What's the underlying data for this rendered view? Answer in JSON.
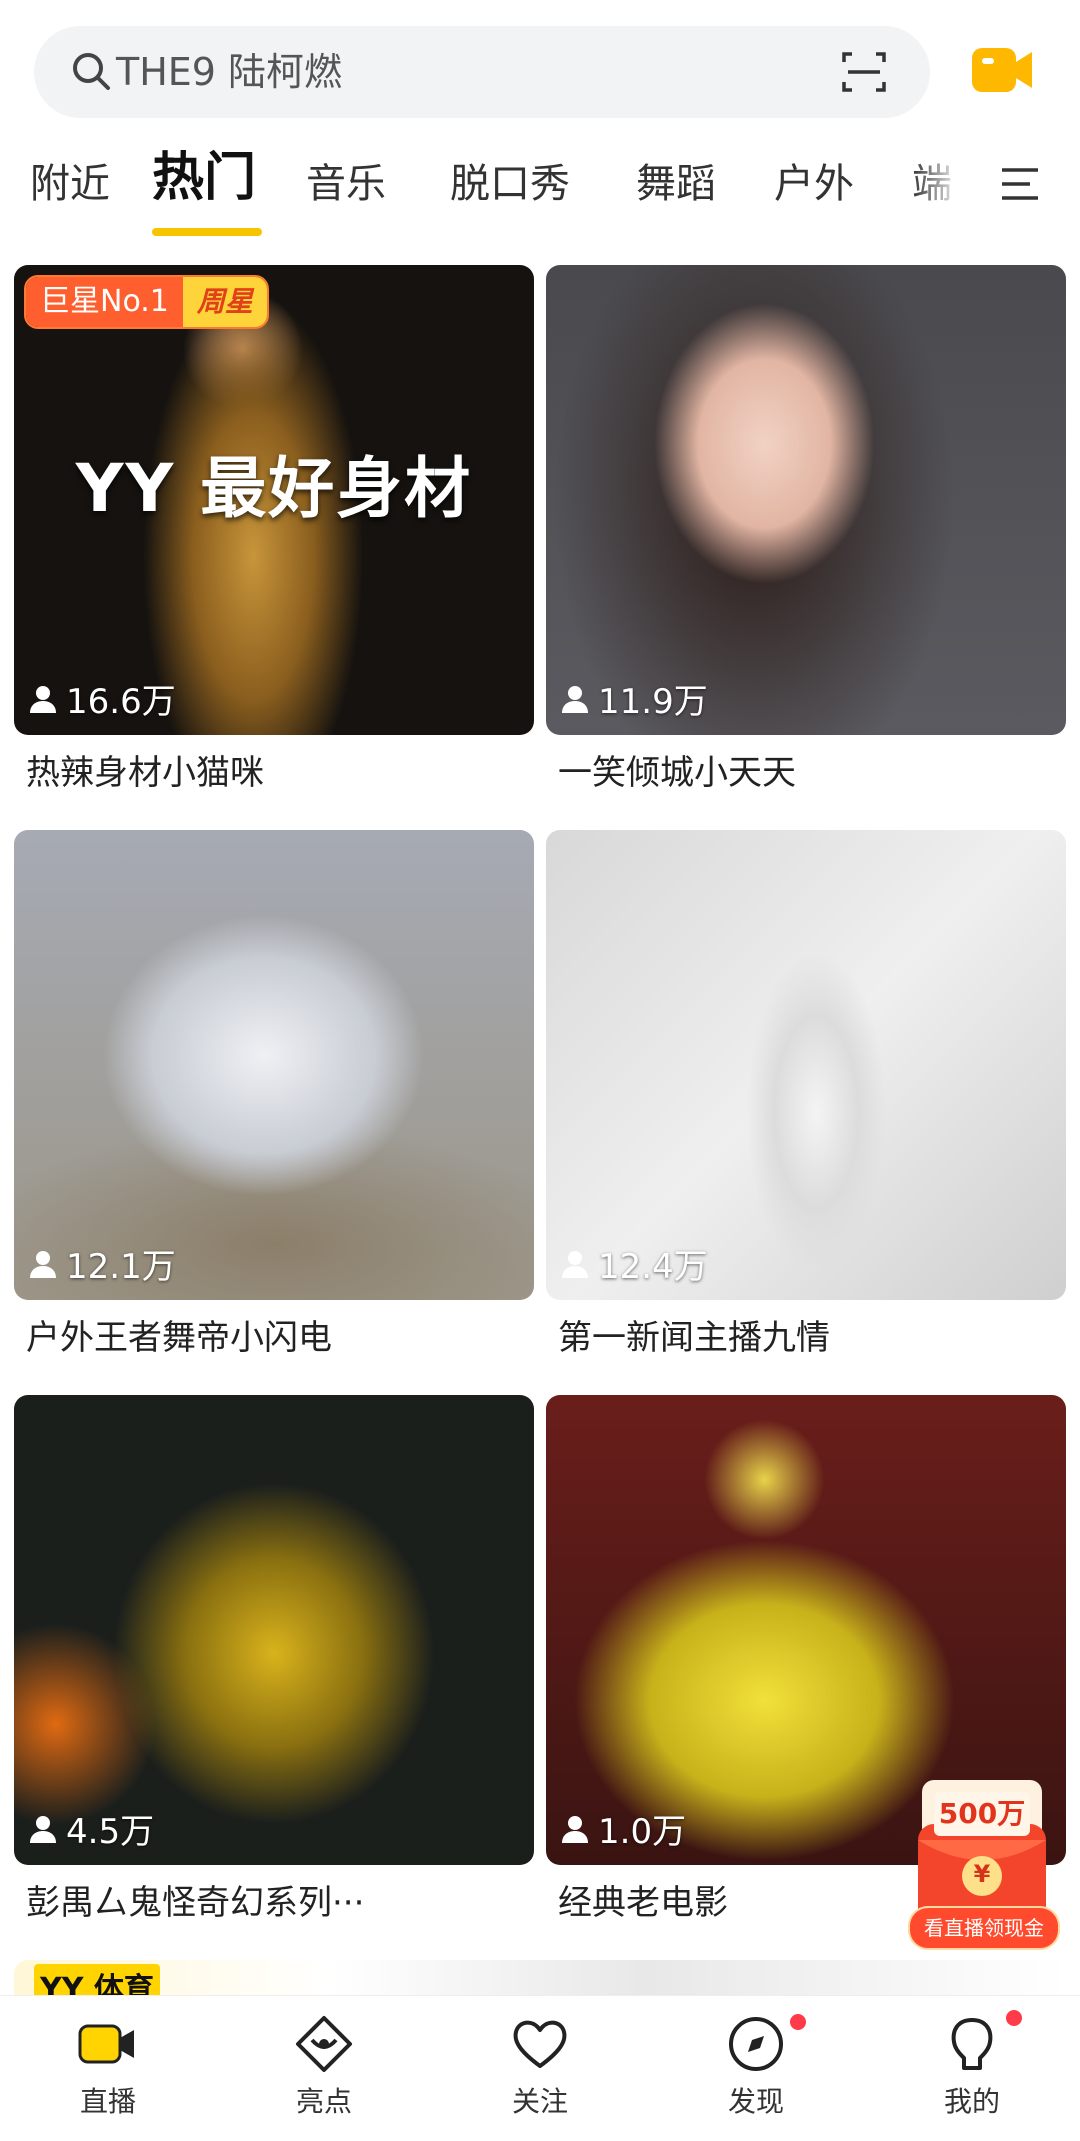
{
  "search": {
    "placeholder_text": "THE9 陆柯燃"
  },
  "tabs": [
    {
      "label": "附近"
    },
    {
      "label": "热门",
      "active": true
    },
    {
      "label": "音乐"
    },
    {
      "label": "脱口秀"
    },
    {
      "label": "舞蹈"
    },
    {
      "label": "户外"
    },
    {
      "label": "端"
    }
  ],
  "cards": [
    {
      "title": "热辣身材小猫咪",
      "viewers": "16.6万",
      "badge_left": "巨星No.1",
      "badge_right": "周星",
      "overlay": "YY 最好身材"
    },
    {
      "title": "一笑倾城小天天",
      "viewers": "11.9万"
    },
    {
      "title": "户外王者舞帝小闪电",
      "viewers": "12.1万"
    },
    {
      "title": "第一新闻主播九情",
      "viewers": "12.4万"
    },
    {
      "title": "彭禺厶鬼怪奇幻系列···",
      "viewers": "4.5万"
    },
    {
      "title": "经典老电影",
      "viewers": "1.0万"
    }
  ],
  "red_packet": {
    "amount": "500万",
    "symbol": "¥",
    "caption": "看直播领现金"
  },
  "banner": {
    "logo": "YY 体育"
  },
  "bottom_nav": [
    {
      "label": "直播",
      "icon": "live-camera-icon",
      "active": true
    },
    {
      "label": "亮点",
      "icon": "eye-icon"
    },
    {
      "label": "关注",
      "icon": "heart-icon"
    },
    {
      "label": "发现",
      "icon": "compass-icon",
      "dot": true
    },
    {
      "label": "我的",
      "icon": "profile-icon",
      "dot": true
    }
  ],
  "colors": {
    "accent": "#f7c500",
    "badge": "#ff5f2e",
    "dot": "#ff3b4a"
  }
}
